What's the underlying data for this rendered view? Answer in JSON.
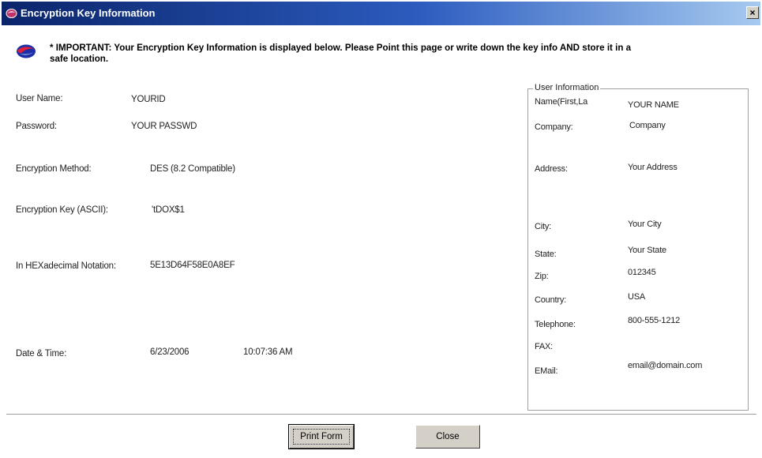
{
  "window": {
    "title": "Encryption Key Information",
    "close_glyph": "×"
  },
  "notice": {
    "text": "* IMPORTANT: Your Encryption Key Information is displayed below. Please Point this page or write down the key info AND store it in a safe location."
  },
  "key_info": {
    "user_name_label": "User Name:",
    "user_name_value": "YOURID",
    "password_label": "Password:",
    "password_value": "YOUR PASSWD",
    "method_label": "Encryption Method:",
    "method_value": "DES (8.2 Compatible)",
    "key_ascii_label": "Encryption Key (ASCII):",
    "key_ascii_value": "'tDOX$1",
    "hex_label": "In HEXadecimal Notation:",
    "hex_value": "5E13D64F58E0A8EF",
    "datetime_label": "Date & Time:",
    "date_value": "6/23/2006",
    "time_value": "10:07:36 AM"
  },
  "user_information": {
    "legend": "User Information",
    "name_label": "Name(First,La",
    "name_value": "YOUR NAME",
    "company_label": "Company:",
    "company_value": "Company",
    "address_label": "Address:",
    "address_value": "Your Address",
    "city_label": "City:",
    "city_value": "Your City",
    "state_label": "State:",
    "state_value": "Your State",
    "zip_label": "Zip:",
    "zip_value": "012345",
    "country_label": "Country:",
    "country_value": "USA",
    "telephone_label": "Telephone:",
    "telephone_value": "800-555-1212",
    "fax_label": "FAX:",
    "fax_value": "",
    "email_label": "EMail:",
    "email_value": "email@domain.com"
  },
  "buttons": {
    "print_label": "Print Form",
    "close_label": "Close"
  },
  "icons": {
    "title_logo": "app-logo-icon",
    "notice_logo": "app-logo-icon"
  },
  "colors": {
    "titlebar_start": "#0a246a",
    "titlebar_end": "#a6caf0",
    "button_face": "#d4d0c8"
  }
}
